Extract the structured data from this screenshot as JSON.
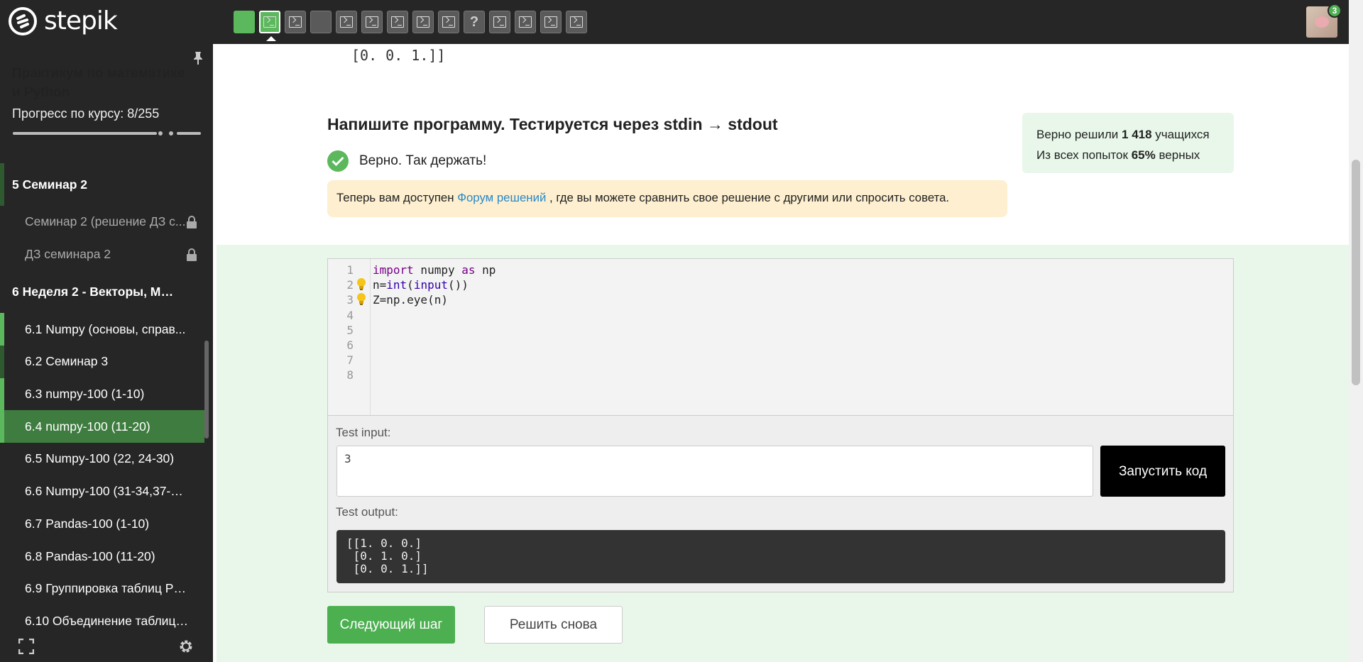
{
  "brand": {
    "name": "stepik"
  },
  "topbar": {
    "steps": [
      {
        "state": "done",
        "icon": "blank"
      },
      {
        "state": "current",
        "icon": "terminal"
      },
      {
        "state": "todo",
        "icon": "terminal"
      },
      {
        "state": "todo",
        "icon": "blank"
      },
      {
        "state": "todo",
        "icon": "terminal"
      },
      {
        "state": "todo",
        "icon": "terminal"
      },
      {
        "state": "todo",
        "icon": "terminal"
      },
      {
        "state": "todo",
        "icon": "terminal"
      },
      {
        "state": "todo",
        "icon": "terminal"
      },
      {
        "state": "todo",
        "icon": "question"
      },
      {
        "state": "todo",
        "icon": "terminal"
      },
      {
        "state": "todo",
        "icon": "terminal"
      },
      {
        "state": "todo",
        "icon": "terminal"
      },
      {
        "state": "todo",
        "icon": "terminal"
      }
    ],
    "notification_count": "3"
  },
  "sidebar": {
    "course_title": "Практикум по математике и Python",
    "progress_label": "Прогресс по курсу:",
    "progress_value": "8/255",
    "progress_fraction": 0.031,
    "items": [
      {
        "type": "section",
        "label": "5  Семинар 2",
        "bar": "dim"
      },
      {
        "type": "lesson",
        "label": "Семинар 2 (решение ДЗ с...",
        "locked": true
      },
      {
        "type": "lesson",
        "label": "ДЗ семинара 2",
        "locked": true
      },
      {
        "type": "section",
        "label": "6  Неделя 2 - Векторы, Ма...",
        "bar": "none"
      },
      {
        "type": "lesson",
        "label": "6.1  Numpy (основы, справ...",
        "bar": "green"
      },
      {
        "type": "lesson",
        "label": "6.2  Семинар 3",
        "bar": "dim"
      },
      {
        "type": "lesson",
        "label": "6.3  numpy-100 (1-10)",
        "bar": "green"
      },
      {
        "type": "lesson",
        "label": "6.4  numpy-100 (11-20)",
        "bar": "green",
        "active": true
      },
      {
        "type": "lesson",
        "label": "6.5  Numpy-100 (22, 24-30)"
      },
      {
        "type": "lesson",
        "label": "6.6  Numpy-100 (31-34,37-40)"
      },
      {
        "type": "lesson",
        "label": "6.7  Pandas-100 (1-10)"
      },
      {
        "type": "lesson",
        "label": "6.8  Pandas-100 (11-20)"
      },
      {
        "type": "lesson",
        "label": "6.9  Группировка таблиц Pa..."
      },
      {
        "type": "lesson",
        "label": "6.10  Объединение таблиц ..."
      }
    ]
  },
  "main": {
    "previous_output_tail": "[0. 0. 1.]]",
    "task_title": "Напишите программу. Тестируется через stdin → stdout",
    "stats": {
      "line1_prefix": "Верно решили",
      "line1_count": "1 418",
      "line1_suffix": "учащихся",
      "line2_prefix": "Из всех попыток",
      "line2_percent": "65%",
      "line2_suffix": "верных"
    },
    "verdict": "Верно. Так держать!",
    "notice": {
      "before": "Теперь вам доступен",
      "link": "Форум решений",
      "after": ", где вы можете сравнить свое решение с другими или спросить совета."
    },
    "editor": {
      "line_numbers": [
        "1",
        "2",
        "3",
        "4",
        "5",
        "6",
        "7",
        "8"
      ],
      "hint_lines": [
        2,
        3
      ],
      "code_lines": [
        [
          {
            "t": "import",
            "c": "kw"
          },
          {
            "t": " numpy ",
            "c": ""
          },
          {
            "t": "as",
            "c": "kw"
          },
          {
            "t": " np",
            "c": ""
          }
        ],
        [
          {
            "t": "n=",
            "c": ""
          },
          {
            "t": "int",
            "c": "bi"
          },
          {
            "t": "(",
            "c": ""
          },
          {
            "t": "input",
            "c": "bi"
          },
          {
            "t": "())",
            "c": ""
          }
        ],
        [
          {
            "t": "Z=np.eye(n)",
            "c": ""
          }
        ]
      ]
    },
    "test_input_label": "Test input:",
    "test_input_value": "3",
    "run_button": "Запустить код",
    "test_output_label": "Test output:",
    "test_output_value": "[[1. 0. 0.]\n [0. 1. 0.]\n [0. 0. 1.]]",
    "next_button": "Следующий шаг",
    "retry_button": "Решить снова"
  }
}
